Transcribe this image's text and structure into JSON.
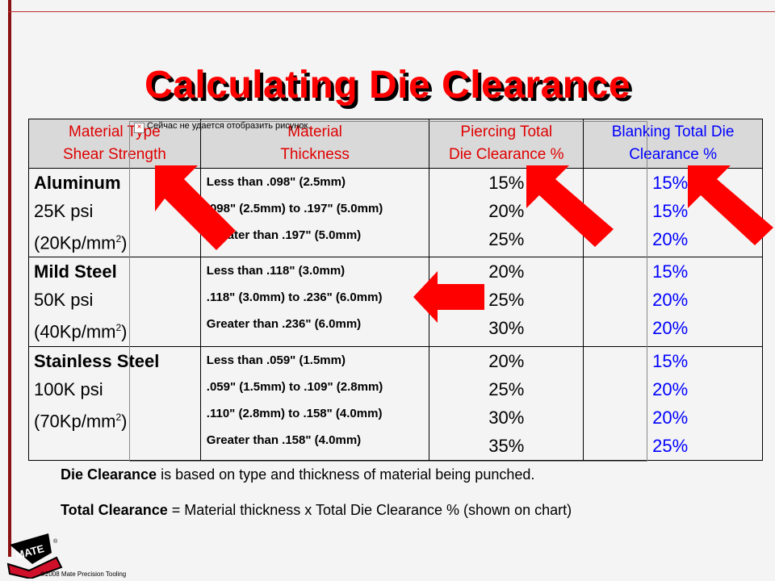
{
  "title": "Calculating Die Clearance",
  "table": {
    "headers": [
      [
        "Material Type",
        "Shear Strength"
      ],
      [
        "Material",
        "Thickness"
      ],
      [
        "Piercing Total",
        "Die Clearance %"
      ],
      [
        "Blanking Total Die",
        "Clearance %"
      ]
    ],
    "rows": [
      {
        "material": "Aluminum",
        "strength": "25K psi",
        "metric": "(20Kp/mm",
        "exp": "2",
        "close": ")",
        "thickness": [
          "Less than .098\" (2.5mm)",
          ".098\" (2.5mm) to .197\" (5.0mm)",
          "Greater than .197\" (5.0mm)"
        ],
        "piercing": [
          "15%",
          "20%",
          "25%"
        ],
        "blanking": [
          "15%",
          "15%",
          "20%"
        ]
      },
      {
        "material": "Mild Steel",
        "strength": "50K psi",
        "metric": "(40Kp/mm",
        "exp": "2",
        "close": ")",
        "thickness": [
          "Less than .118\" (3.0mm)",
          ".118\" (3.0mm) to .236\" (6.0mm)",
          "Greater than .236\" (6.0mm)"
        ],
        "piercing": [
          "20%",
          "25%",
          "30%"
        ],
        "blanking": [
          "15%",
          "20%",
          "20%"
        ]
      },
      {
        "material": "Stainless Steel",
        "strength": "100K psi",
        "metric": "(70Kp/mm",
        "exp": "2",
        "close": ")",
        "thickness": [
          "Less than .059\" (1.5mm)",
          ".059\" (1.5mm) to .109\" (2.8mm)",
          ".110\" (2.8mm) to .158\" (4.0mm)",
          "Greater than .158\" (4.0mm)"
        ],
        "piercing": [
          "20%",
          "25%",
          "30%",
          "35%"
        ],
        "blanking": [
          "15%",
          "20%",
          "20%",
          "25%"
        ]
      }
    ]
  },
  "placeholder_text": "Сейчас не удается отобразить рисунок.",
  "footer": {
    "line1_bold": "Die Clearance",
    "line1_rest": " is based on type and thickness of material being punched.",
    "line2_bold": "Total Clearance",
    "line2_rest": " = Material thickness x Total Die Clearance % (shown on chart)"
  },
  "logo": "MATE",
  "copyright": "©2008  Mate Precision Tooling",
  "colors": {
    "title": "#ff0000",
    "header_red": "#e00000",
    "header_blue": "#0000ff",
    "arrow": "#ff0000"
  }
}
